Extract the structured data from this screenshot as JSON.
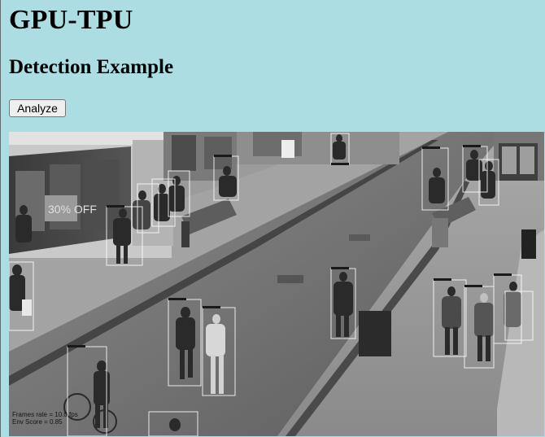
{
  "header": {
    "title": "GPU-TPU"
  },
  "section": {
    "title": "Detection Example"
  },
  "actions": {
    "analyze_label": "Analyze"
  },
  "detection": {
    "overlay": {
      "frame_rate": "Frames rate = 10.0 fps",
      "env_score": "Env Score = 0.85"
    },
    "box_color": "#ffffff",
    "image_tone": "grayscale"
  }
}
